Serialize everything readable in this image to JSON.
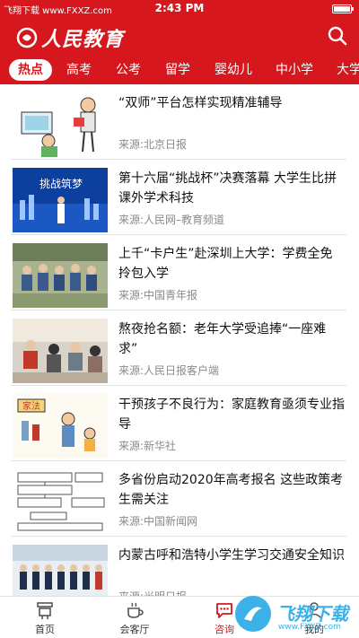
{
  "status_bar": {
    "carrier": "飞翔下载 www.FXXZ.com",
    "time": "2:43 PM"
  },
  "header": {
    "app_name": "人民教育",
    "search_icon": "search-icon"
  },
  "tabs": [
    {
      "label": "热点",
      "active": true
    },
    {
      "label": "高考"
    },
    {
      "label": "公考"
    },
    {
      "label": "留学"
    },
    {
      "label": "婴幼儿"
    },
    {
      "label": "中小学"
    },
    {
      "label": "大学"
    }
  ],
  "news": [
    {
      "title": "“双师”平台怎样实现精准辅导",
      "source": "来源:北京日报"
    },
    {
      "title": "第十六届“挑战杯”决赛落幕 大学生比拼课外学术科技",
      "source": "来源:人民网–教育频道"
    },
    {
      "title": "上千“卡户生”赴深圳上大学：学费全免拎包入学",
      "source": "来源:中国青年报"
    },
    {
      "title": "熬夜抢名额：老年大学受追捧“一座难求”",
      "source": "来源:人民日报客户端"
    },
    {
      "title": "干预孩子不良行为：家庭教育亟须专业指导",
      "source": "来源:新华社"
    },
    {
      "title": "多省份启动2020年高考报名 这些政策考生需关注",
      "source": "来源:中国新闻网"
    },
    {
      "title": "内蒙古呼和浩特小学生学习交通安全知识",
      "source": "来源:光明日报"
    }
  ],
  "thumb_texts": {
    "banner": "挑战筑梦",
    "family_rule": "家法"
  },
  "tabbar": [
    {
      "label": "首页",
      "icon": "home-icon"
    },
    {
      "label": "会客厅",
      "icon": "cup-icon"
    },
    {
      "label": "咨询",
      "icon": "chat-icon",
      "active": true
    },
    {
      "label": "我的",
      "icon": "user-icon"
    }
  ],
  "watermark": {
    "text": "飞翔下载",
    "url": "www.FXXZ.com"
  },
  "colors": {
    "brand_red": "#d6171d",
    "watermark_blue": "#3cb1e8"
  }
}
